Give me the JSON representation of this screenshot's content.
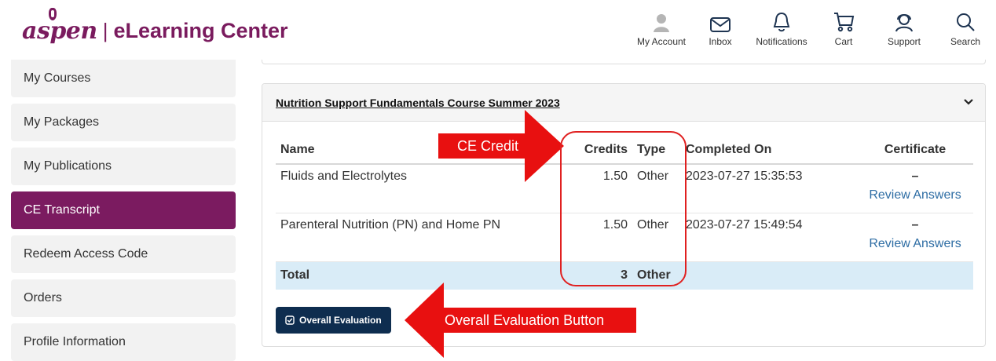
{
  "header": {
    "logo_brand": "aspen",
    "logo_sep": "|",
    "logo_title": "eLearning Center",
    "nav": [
      {
        "label": "My Account",
        "icon": "user-icon"
      },
      {
        "label": "Inbox",
        "icon": "envelope-icon"
      },
      {
        "label": "Notifications",
        "icon": "bell-icon"
      },
      {
        "label": "Cart",
        "icon": "cart-icon"
      },
      {
        "label": "Support",
        "icon": "support-icon"
      },
      {
        "label": "Search",
        "icon": "search-icon"
      }
    ]
  },
  "sidebar": {
    "items": [
      {
        "label": "My Courses",
        "active": false
      },
      {
        "label": "My Packages",
        "active": false
      },
      {
        "label": "My Publications",
        "active": false
      },
      {
        "label": "CE Transcript",
        "active": true
      },
      {
        "label": "Redeem Access Code",
        "active": false
      },
      {
        "label": "Orders",
        "active": false
      },
      {
        "label": "Profile Information",
        "active": false
      }
    ]
  },
  "course": {
    "title": "Nutrition Support Fundamentals Course Summer 2023",
    "columns": {
      "name": "Name",
      "credits": "Credits",
      "type": "Type",
      "completed": "Completed On",
      "certificate": "Certificate"
    },
    "rows": [
      {
        "name": "Fluids and Electrolytes",
        "credits": "1.50",
        "type": "Other",
        "completed": "2023-07-27 15:35:53",
        "certificate": "–",
        "review": "Review Answers"
      },
      {
        "name": "Parenteral Nutrition (PN) and Home PN",
        "credits": "1.50",
        "type": "Other",
        "completed": "2023-07-27 15:49:54",
        "certificate": "–",
        "review": "Review Answers"
      }
    ],
    "total": {
      "label": "Total",
      "credits": "3",
      "type": "Other"
    },
    "eval_button": "Overall Evaluation"
  },
  "annotations": {
    "ce_credit": "CE Credit",
    "eval_button": "Overall Evaluation Button",
    "color": "#e81010"
  },
  "colors": {
    "brand": "#7b1b60",
    "button": "#0e2d4f",
    "link": "#2e6da4",
    "total_row": "#d9ecf7"
  }
}
